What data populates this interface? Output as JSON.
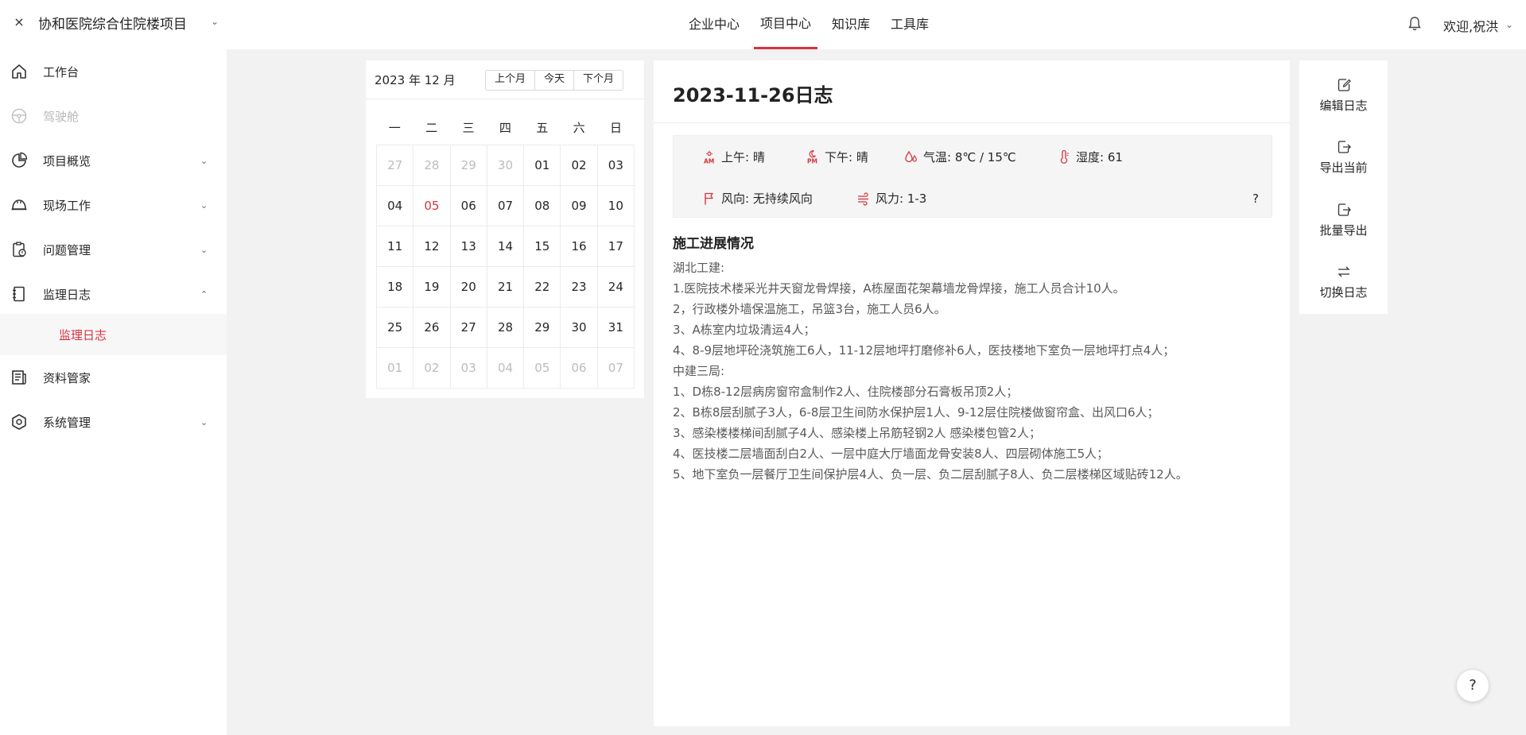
{
  "header": {
    "close_icon": "×",
    "project_name": "协和医院综合住院楼项目",
    "project_chevron": "⌄",
    "nav": [
      {
        "label": "企业中心"
      },
      {
        "label": "项目中心"
      },
      {
        "label": "知识库"
      },
      {
        "label": "工具库"
      }
    ],
    "active_nav": "项目中心",
    "bell_icon": "bell-icon",
    "welcome": "欢迎,祝洪",
    "welcome_chevron": "⌄"
  },
  "sidebar": {
    "items": [
      {
        "label": "工作台",
        "icon": "home-icon"
      },
      {
        "label": "驾驶舱",
        "icon": "steering-wheel-icon",
        "disabled": true
      },
      {
        "label": "项目概览",
        "icon": "pie-chart-icon",
        "chevron": "⌄"
      },
      {
        "label": "现场工作",
        "icon": "helmet-icon",
        "chevron": "⌄"
      },
      {
        "label": "问题管理",
        "icon": "clipboard-alert-icon",
        "chevron": "⌄"
      },
      {
        "label": "监理日志",
        "icon": "notebook-icon",
        "chevron": "⌃"
      },
      {
        "label": "资料管家",
        "icon": "newspaper-icon"
      },
      {
        "label": "系统管理",
        "icon": "settings-hex-icon",
        "chevron": "⌄"
      }
    ],
    "active_sub": "监理日志"
  },
  "calendar": {
    "month_label": "2023 年 12 月",
    "buttons": {
      "prev": "上个月",
      "today": "今天",
      "next": "下个月"
    },
    "weekdays": [
      "一",
      "二",
      "三",
      "四",
      "五",
      "六",
      "日"
    ],
    "days": [
      {
        "d": "27",
        "muted": true
      },
      {
        "d": "28",
        "muted": true
      },
      {
        "d": "29",
        "muted": true
      },
      {
        "d": "30",
        "muted": true
      },
      {
        "d": "01"
      },
      {
        "d": "02"
      },
      {
        "d": "03"
      },
      {
        "d": "04"
      },
      {
        "d": "05",
        "marked": true
      },
      {
        "d": "06"
      },
      {
        "d": "07"
      },
      {
        "d": "08"
      },
      {
        "d": "09"
      },
      {
        "d": "10"
      },
      {
        "d": "11"
      },
      {
        "d": "12"
      },
      {
        "d": "13"
      },
      {
        "d": "14"
      },
      {
        "d": "15"
      },
      {
        "d": "16"
      },
      {
        "d": "17"
      },
      {
        "d": "18"
      },
      {
        "d": "19"
      },
      {
        "d": "20"
      },
      {
        "d": "21"
      },
      {
        "d": "22"
      },
      {
        "d": "23"
      },
      {
        "d": "24"
      },
      {
        "d": "25"
      },
      {
        "d": "26"
      },
      {
        "d": "27"
      },
      {
        "d": "28"
      },
      {
        "d": "29"
      },
      {
        "d": "30"
      },
      {
        "d": "31"
      },
      {
        "d": "01",
        "muted": true
      },
      {
        "d": "02",
        "muted": true
      },
      {
        "d": "03",
        "muted": true
      },
      {
        "d": "04",
        "muted": true
      },
      {
        "d": "05",
        "muted": true
      },
      {
        "d": "06",
        "muted": true
      },
      {
        "d": "07",
        "muted": true
      }
    ]
  },
  "log": {
    "title": "2023-11-26日志",
    "weather": {
      "am": "上午: 晴",
      "pm": "下午: 晴",
      "temp": "气温: 8℃ / 15℃",
      "humidity": "湿度: 61",
      "wind_dir": "风向: 无持续风向",
      "wind_force": "风力: 1-3",
      "help": "?"
    },
    "section_title": "施工进展情况",
    "lines": [
      "湖北工建:",
      "1.医院技术楼采光井天窗龙骨焊接，A栋屋面花架幕墙龙骨焊接，施工人员合计10人。",
      "2，行政楼外墙保温施工，吊篮3台，施工人员6人。",
      "3、A栋室内垃圾清运4人；",
      "4、8-9层地坪砼浇筑施工6人，11-12层地坪打磨修补6人，医技楼地下室负一层地坪打点4人；",
      "中建三局:",
      "1、D栋8-12层病房窗帘盒制作2人、住院楼部分石膏板吊顶2人；",
      "2、B栋8层刮腻子3人，6-8层卫生间防水保护层1人、9-12层住院楼做窗帘盒、出风口6人；",
      "3、感染楼楼梯间刮腻子4人、感染楼上吊筋轻钢2人 感染楼包管2人；",
      "4、医技楼二层墙面刮白2人、一层中庭大厅墙面龙骨安装8人、四层砌体施工5人；",
      "5、地下室负一层餐厅卫生间保护层4人、负一层、负二层刮腻子8人、负二层楼梯区域贴砖12人。"
    ]
  },
  "actions": [
    {
      "label": "编辑日志",
      "icon": "edit-icon"
    },
    {
      "label": "导出当前",
      "icon": "export-icon"
    },
    {
      "label": "批量导出",
      "icon": "batch-export-icon"
    },
    {
      "label": "切换日志",
      "icon": "switch-icon"
    }
  ],
  "help_fab": "?",
  "colors": {
    "accent": "#d6333d",
    "muted_text": "#bcbcbc",
    "page_bg": "#f2f2f2"
  }
}
